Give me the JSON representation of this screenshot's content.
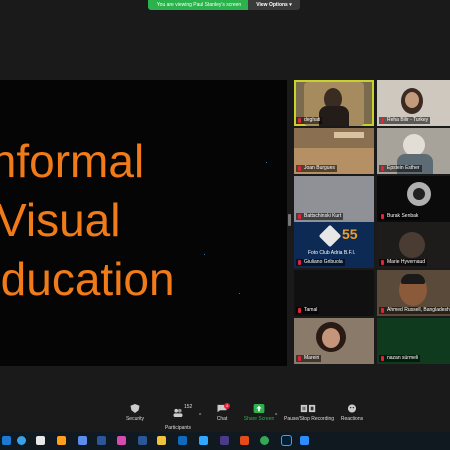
{
  "share_banner": {
    "viewing_text": "You are viewing Paul Stanley's screen",
    "view_options_label": "View Options ▾"
  },
  "slide": {
    "lines": [
      "Informal",
      "Visual",
      "Education"
    ],
    "text_color": "#f07b18"
  },
  "participants_gallery": [
    {
      "name": "deghati",
      "active_speaker": true
    },
    {
      "name": "Reha Bilir - Turkey"
    },
    {
      "name": "Joan Burgues"
    },
    {
      "name": "Epstein Esther"
    },
    {
      "name": "Battschinski Kurt"
    },
    {
      "name": "Burak Senbak"
    },
    {
      "name": "Giuliano Gribuola",
      "overlay_text": "Foto Club Adria B.F.I."
    },
    {
      "name": "Marie Hyvernaud"
    },
    {
      "name": "Tamal"
    },
    {
      "name": "Ahmed Russell, Bangladesh"
    },
    {
      "name": "Mareiri"
    },
    {
      "name": "nazan sürmeli"
    }
  ],
  "toolbar": {
    "security": "Security",
    "participants": "Participants",
    "participants_count": "152",
    "chat": "Chat",
    "chat_badge": "4",
    "share_screen": "Share Screen",
    "pause_stop_recording": "Pause/Stop Recording",
    "reactions": "Reactions"
  },
  "colors": {
    "share_green": "#2bb24c",
    "active_speaker_border": "#c9d22b",
    "muted_red": "#e0243a",
    "chat_badge": "#e0243a"
  },
  "taskbar_icons": [
    "windows-start-icon",
    "edge-icon",
    "calendar-icon",
    "file-explorer-icon",
    "video-icon",
    "mail-icon",
    "photos-icon",
    "word-icon",
    "explorer-icon",
    "outlook-icon",
    "lightroom-icon",
    "downloads-icon",
    "chrome-icon",
    "photoshop-icon",
    "zoom-icon"
  ]
}
